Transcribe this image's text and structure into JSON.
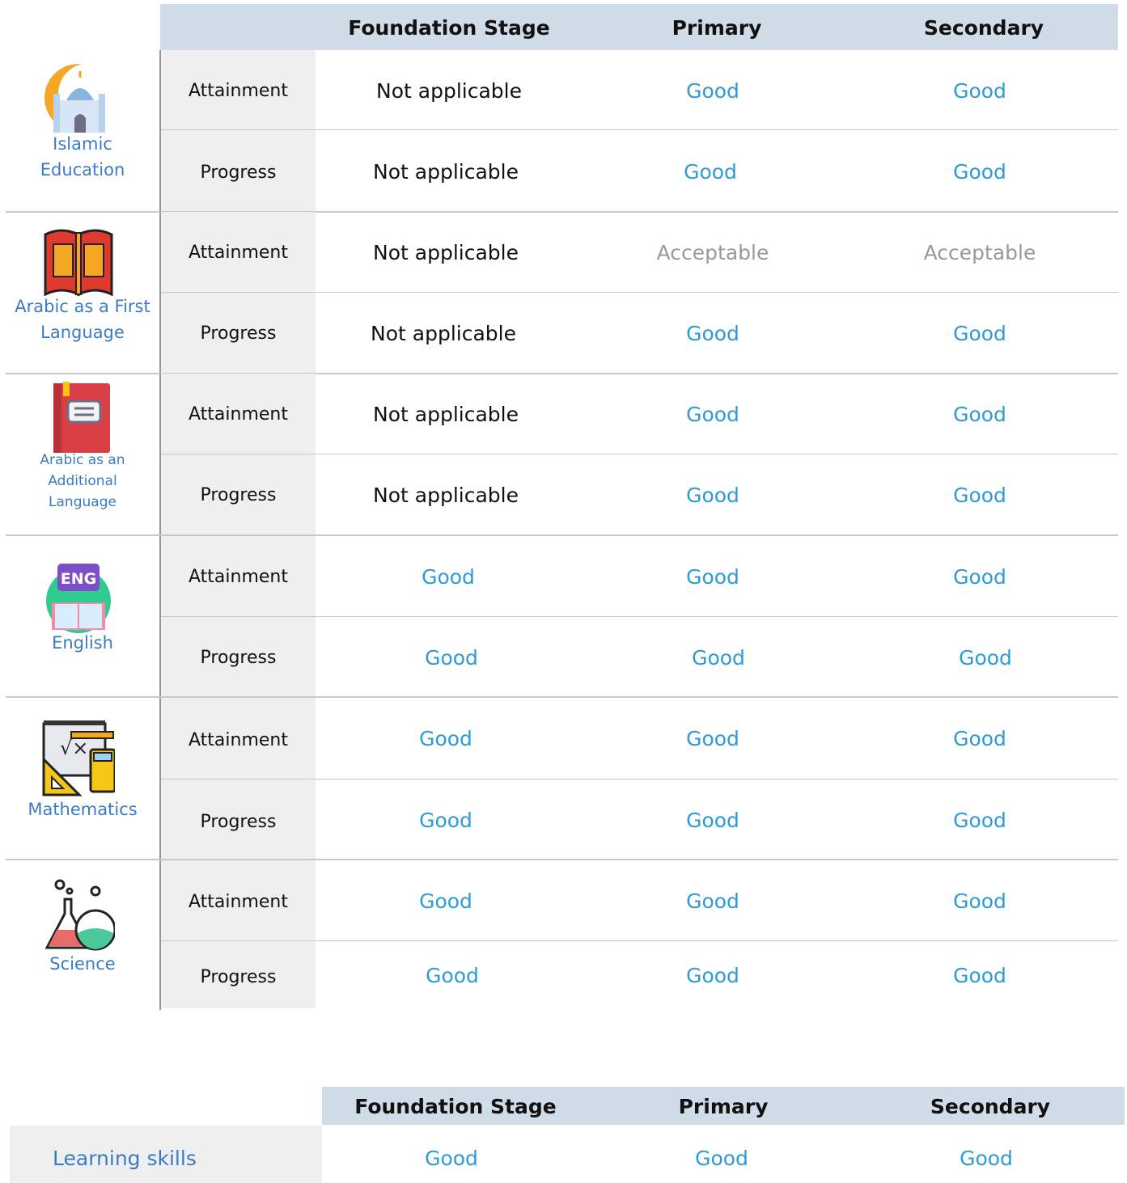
{
  "table1": {
    "headers": [
      "Foundation Stage",
      "Primary",
      "Secondary"
    ],
    "subjects": [
      {
        "name": "Islamic Education",
        "icon": "mosque-icon",
        "rows": [
          {
            "label": "Attainment",
            "values": [
              "Not applicable",
              "Good",
              "Good"
            ]
          },
          {
            "label": "Progress",
            "values": [
              "Not applicable",
              "Good",
              "Good"
            ]
          }
        ]
      },
      {
        "name": "Arabic as a First Language",
        "icon": "open-book-icon",
        "rows": [
          {
            "label": "Attainment",
            "values": [
              "Not applicable",
              "Acceptable",
              "Acceptable"
            ]
          },
          {
            "label": "Progress",
            "values": [
              "Not applicable",
              "Good",
              "Good"
            ]
          }
        ]
      },
      {
        "name": "Arabic as an Additional Language",
        "icon": "red-book-icon",
        "rows": [
          {
            "label": "Attainment",
            "values": [
              "Not applicable",
              "Good",
              "Good"
            ]
          },
          {
            "label": "Progress",
            "values": [
              "Not applicable",
              "Good",
              "Good"
            ]
          }
        ]
      },
      {
        "name": "English",
        "icon": "eng-speech-book-icon",
        "rows": [
          {
            "label": "Attainment",
            "values": [
              "Good",
              "Good",
              "Good"
            ]
          },
          {
            "label": "Progress",
            "values": [
              "Good",
              "Good",
              "Good"
            ]
          }
        ]
      },
      {
        "name": "Mathematics",
        "icon": "math-board-calculator-icon",
        "rows": [
          {
            "label": "Attainment",
            "values": [
              "Good",
              "Good",
              "Good"
            ]
          },
          {
            "label": "Progress",
            "values": [
              "Good",
              "Good",
              "Good"
            ]
          }
        ]
      },
      {
        "name": "Science",
        "icon": "flasks-icon",
        "rows": [
          {
            "label": "Attainment",
            "values": [
              "Good",
              "Good",
              "Good"
            ]
          },
          {
            "label": "Progress",
            "values": [
              "Good",
              "Good",
              "Good"
            ]
          }
        ]
      }
    ]
  },
  "table2": {
    "headers": [
      "Foundation Stage",
      "Primary",
      "Secondary"
    ],
    "rows": [
      {
        "label": "Learning skills",
        "values": [
          "Good",
          "Good",
          "Good"
        ]
      }
    ]
  },
  "colors": {
    "good": "#2e9bd6",
    "acceptable": "#999999",
    "not_applicable": "#111111",
    "header_bg": "#d0dce8",
    "subject_text": "#3a7cc4"
  }
}
